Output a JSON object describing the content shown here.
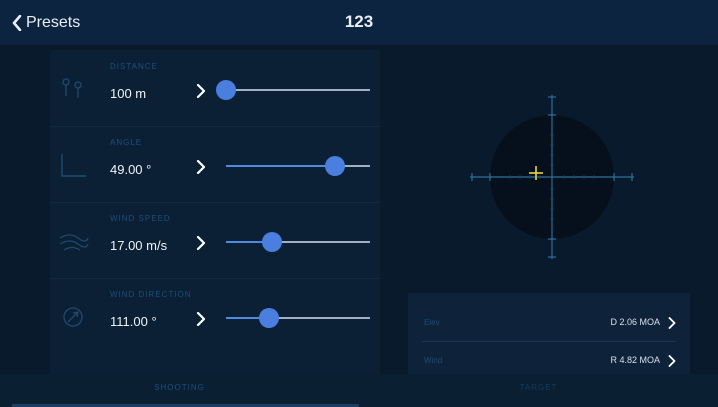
{
  "header": {
    "back_label": "Presets",
    "title": "123"
  },
  "inputs": [
    {
      "caption": "DISTANCE",
      "value": "100 m",
      "icon": "distance-icon",
      "slider": 0.0
    },
    {
      "caption": "ANGLE",
      "value": "49.00 °",
      "icon": "angle-icon",
      "slider": 0.76
    },
    {
      "caption": "WIND SPEED",
      "value": "17.00 m/s",
      "icon": "wind-speed-icon",
      "slider": 0.32
    },
    {
      "caption": "WIND DIRECTION",
      "value": "111.00 °",
      "icon": "wind-direction-icon",
      "slider": 0.3
    }
  ],
  "results": [
    {
      "label": "Elev",
      "value": "D 2.06 MOA"
    },
    {
      "label": "Wind",
      "value": "R 4.82 MOA"
    }
  ],
  "tabs": [
    {
      "label": "SHOOTING",
      "active": true
    },
    {
      "label": "TARGET",
      "active": false
    }
  ],
  "colors": {
    "accent": "#4a7fe0",
    "background": "#0b1a2c",
    "reticle_cross": "#e8d63a"
  }
}
